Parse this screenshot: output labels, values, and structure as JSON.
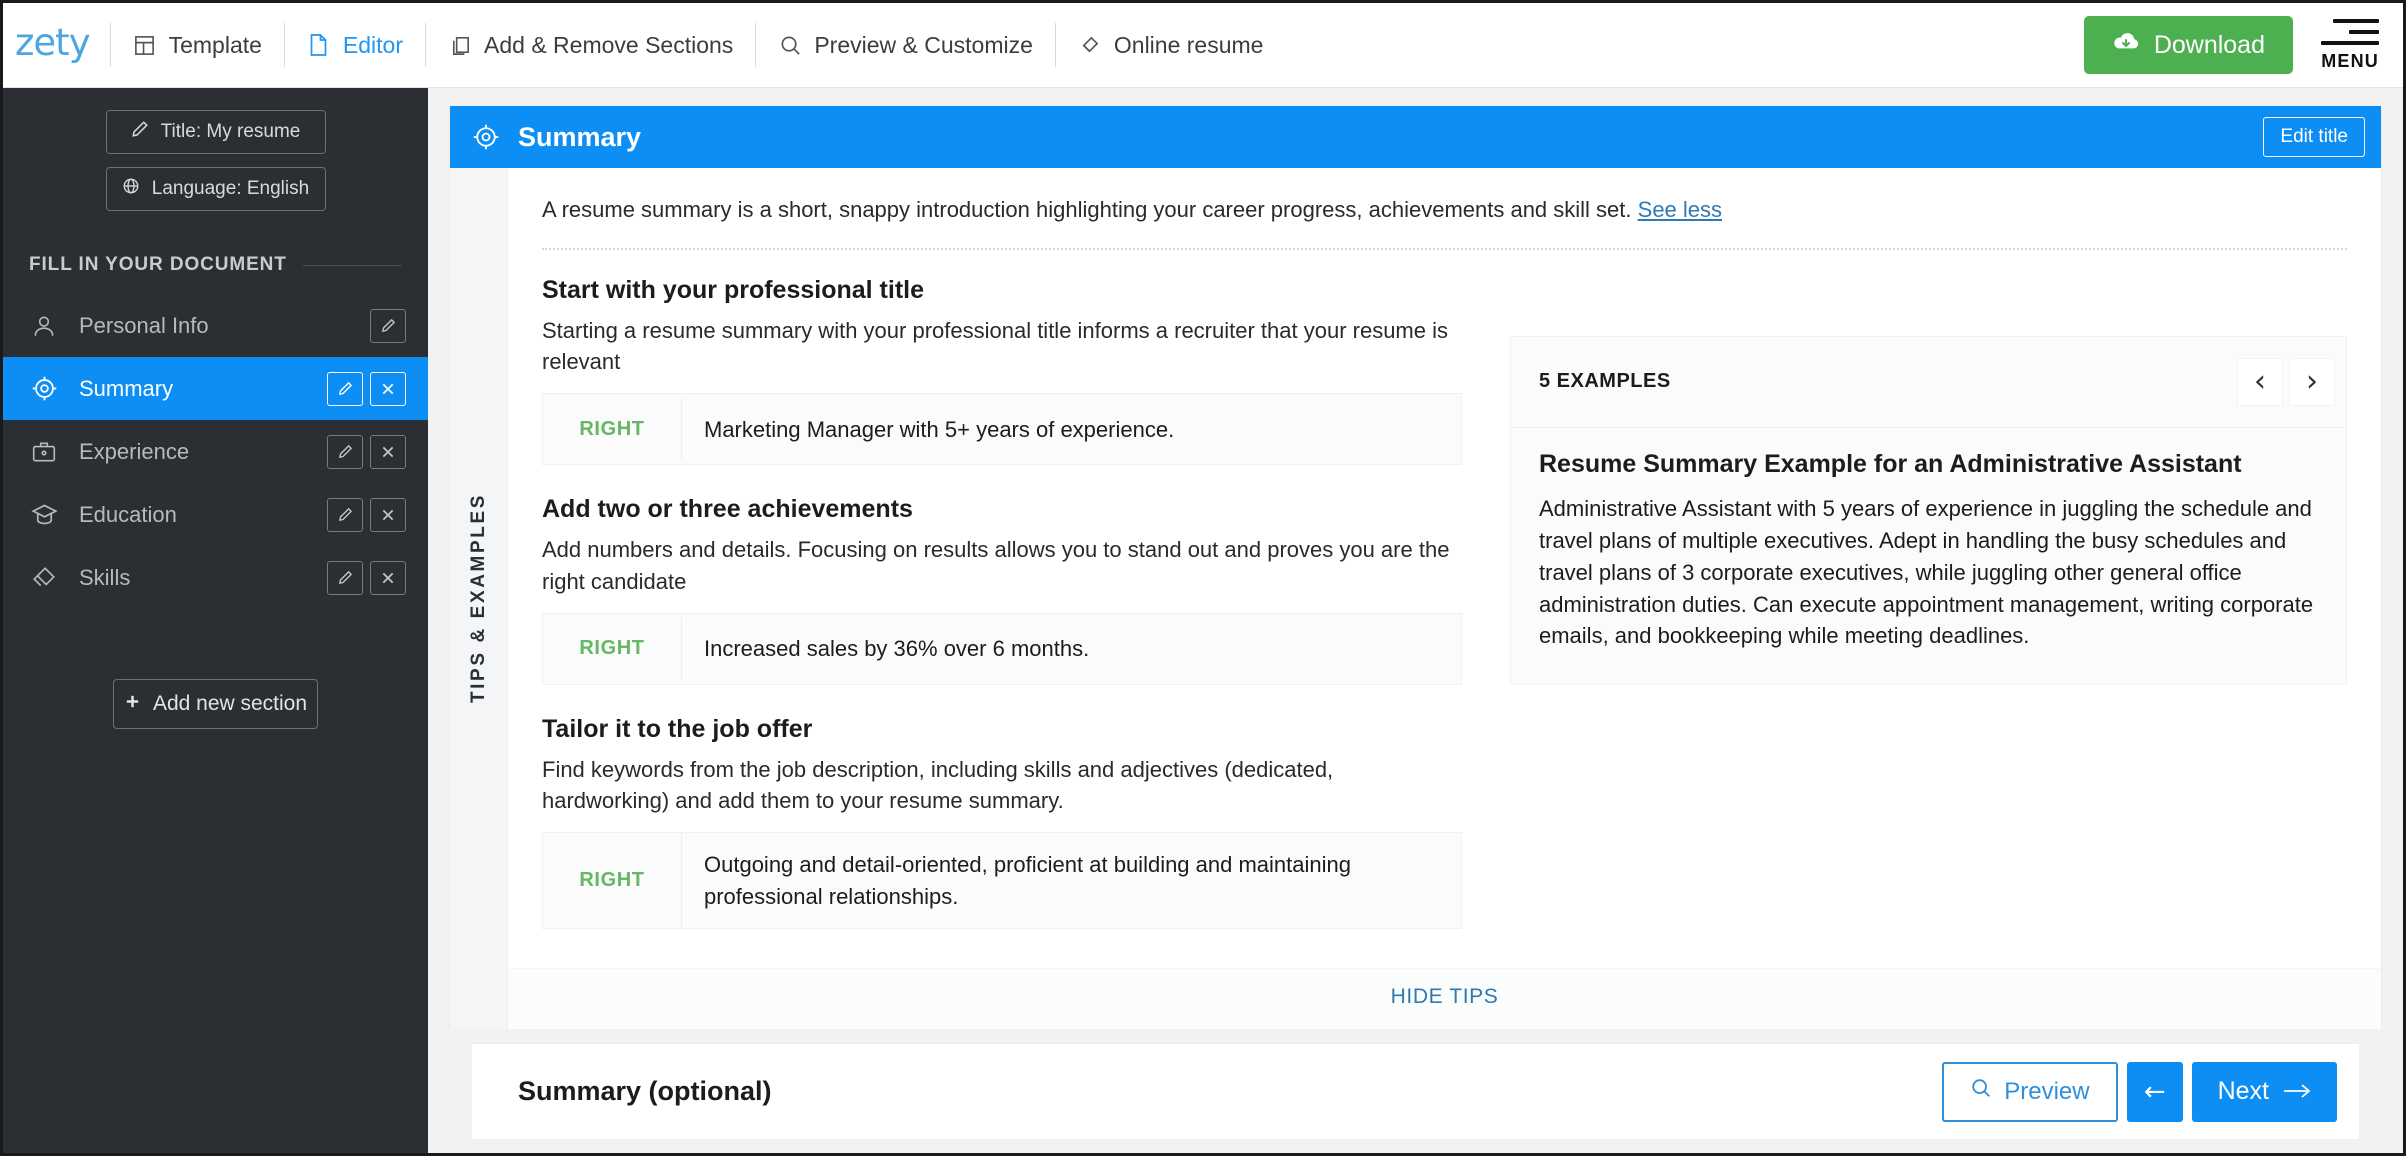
{
  "topbar": {
    "logo": "zety",
    "nav": [
      {
        "label": "Template",
        "icon": "layout-icon",
        "active": false
      },
      {
        "label": "Editor",
        "icon": "document-icon",
        "active": true
      },
      {
        "label": "Add & Remove Sections",
        "icon": "copy-icon",
        "active": false
      },
      {
        "label": "Preview & Customize",
        "icon": "search-icon",
        "active": false
      },
      {
        "label": "Online resume",
        "icon": "link-icon",
        "active": false
      }
    ],
    "download_label": "Download",
    "menu_label": "MENU",
    "download_color": "#4caf50",
    "accent_color": "#2196f3"
  },
  "sidebar": {
    "title_pill": "Title: My resume",
    "language_pill": "Language: English",
    "section_header": "FILL IN YOUR DOCUMENT",
    "items": [
      {
        "label": "Personal Info",
        "icon": "person-icon",
        "active": false,
        "has_delete": false
      },
      {
        "label": "Summary",
        "icon": "target-icon",
        "active": true,
        "has_delete": true
      },
      {
        "label": "Experience",
        "icon": "briefcase-icon",
        "active": false,
        "has_delete": true
      },
      {
        "label": "Education",
        "icon": "graduation-cap-icon",
        "active": false,
        "has_delete": true
      },
      {
        "label": "Skills",
        "icon": "puzzle-icon",
        "active": false,
        "has_delete": true
      }
    ],
    "add_section_label": "Add new section",
    "active_color": "#0c8ef5",
    "background_color": "#2b2f33"
  },
  "summary_panel": {
    "header_title": "Summary",
    "header_icon": "target-icon",
    "edit_title_label": "Edit title",
    "header_color": "#0c8ef5",
    "intro_text": "A resume summary is a short, snappy introduction highlighting your career progress, achievements and skill set.",
    "see_less_label": "See less",
    "rail_label": "TIPS & EXAMPLES",
    "hide_tips_label": "HIDE TIPS",
    "tips": [
      {
        "heading": "Start with your professional title",
        "body": "Starting a resume summary with your professional title informs a recruiter that your resume is relevant",
        "tag": "RIGHT",
        "example": "Marketing Manager with 5+ years of experience."
      },
      {
        "heading": "Add two or three achievements",
        "body": "Add numbers and details. Focusing on results allows you to stand out and proves you are the right candidate",
        "tag": "RIGHT",
        "example": "Increased sales by 36% over 6 months."
      },
      {
        "heading": "Tailor it to the job offer",
        "body": "Find keywords from the job description, including skills and adjectives (dedicated, hardworking) and add them to your resume summary.",
        "tag": "RIGHT",
        "example": "Outgoing and detail-oriented, proficient at building and maintaining professional relationships."
      }
    ],
    "examples": {
      "count_label": "5 EXAMPLES",
      "prev_icon": "chevron-left-icon",
      "next_icon": "chevron-right-icon",
      "title": "Resume Summary Example for an Administrative Assistant",
      "text": "Administrative Assistant with 5 years of experience in juggling the schedule and travel plans of multiple executives. Adept in handling the busy schedules and travel plans of 3 corporate executives, while juggling other general office administration duties. Can execute appointment management, writing corporate emails, and bookkeeping while meeting deadlines."
    }
  },
  "bottombar": {
    "title": "Summary (optional)",
    "preview_label": "Preview",
    "back_label": "←",
    "next_label": "Next"
  }
}
